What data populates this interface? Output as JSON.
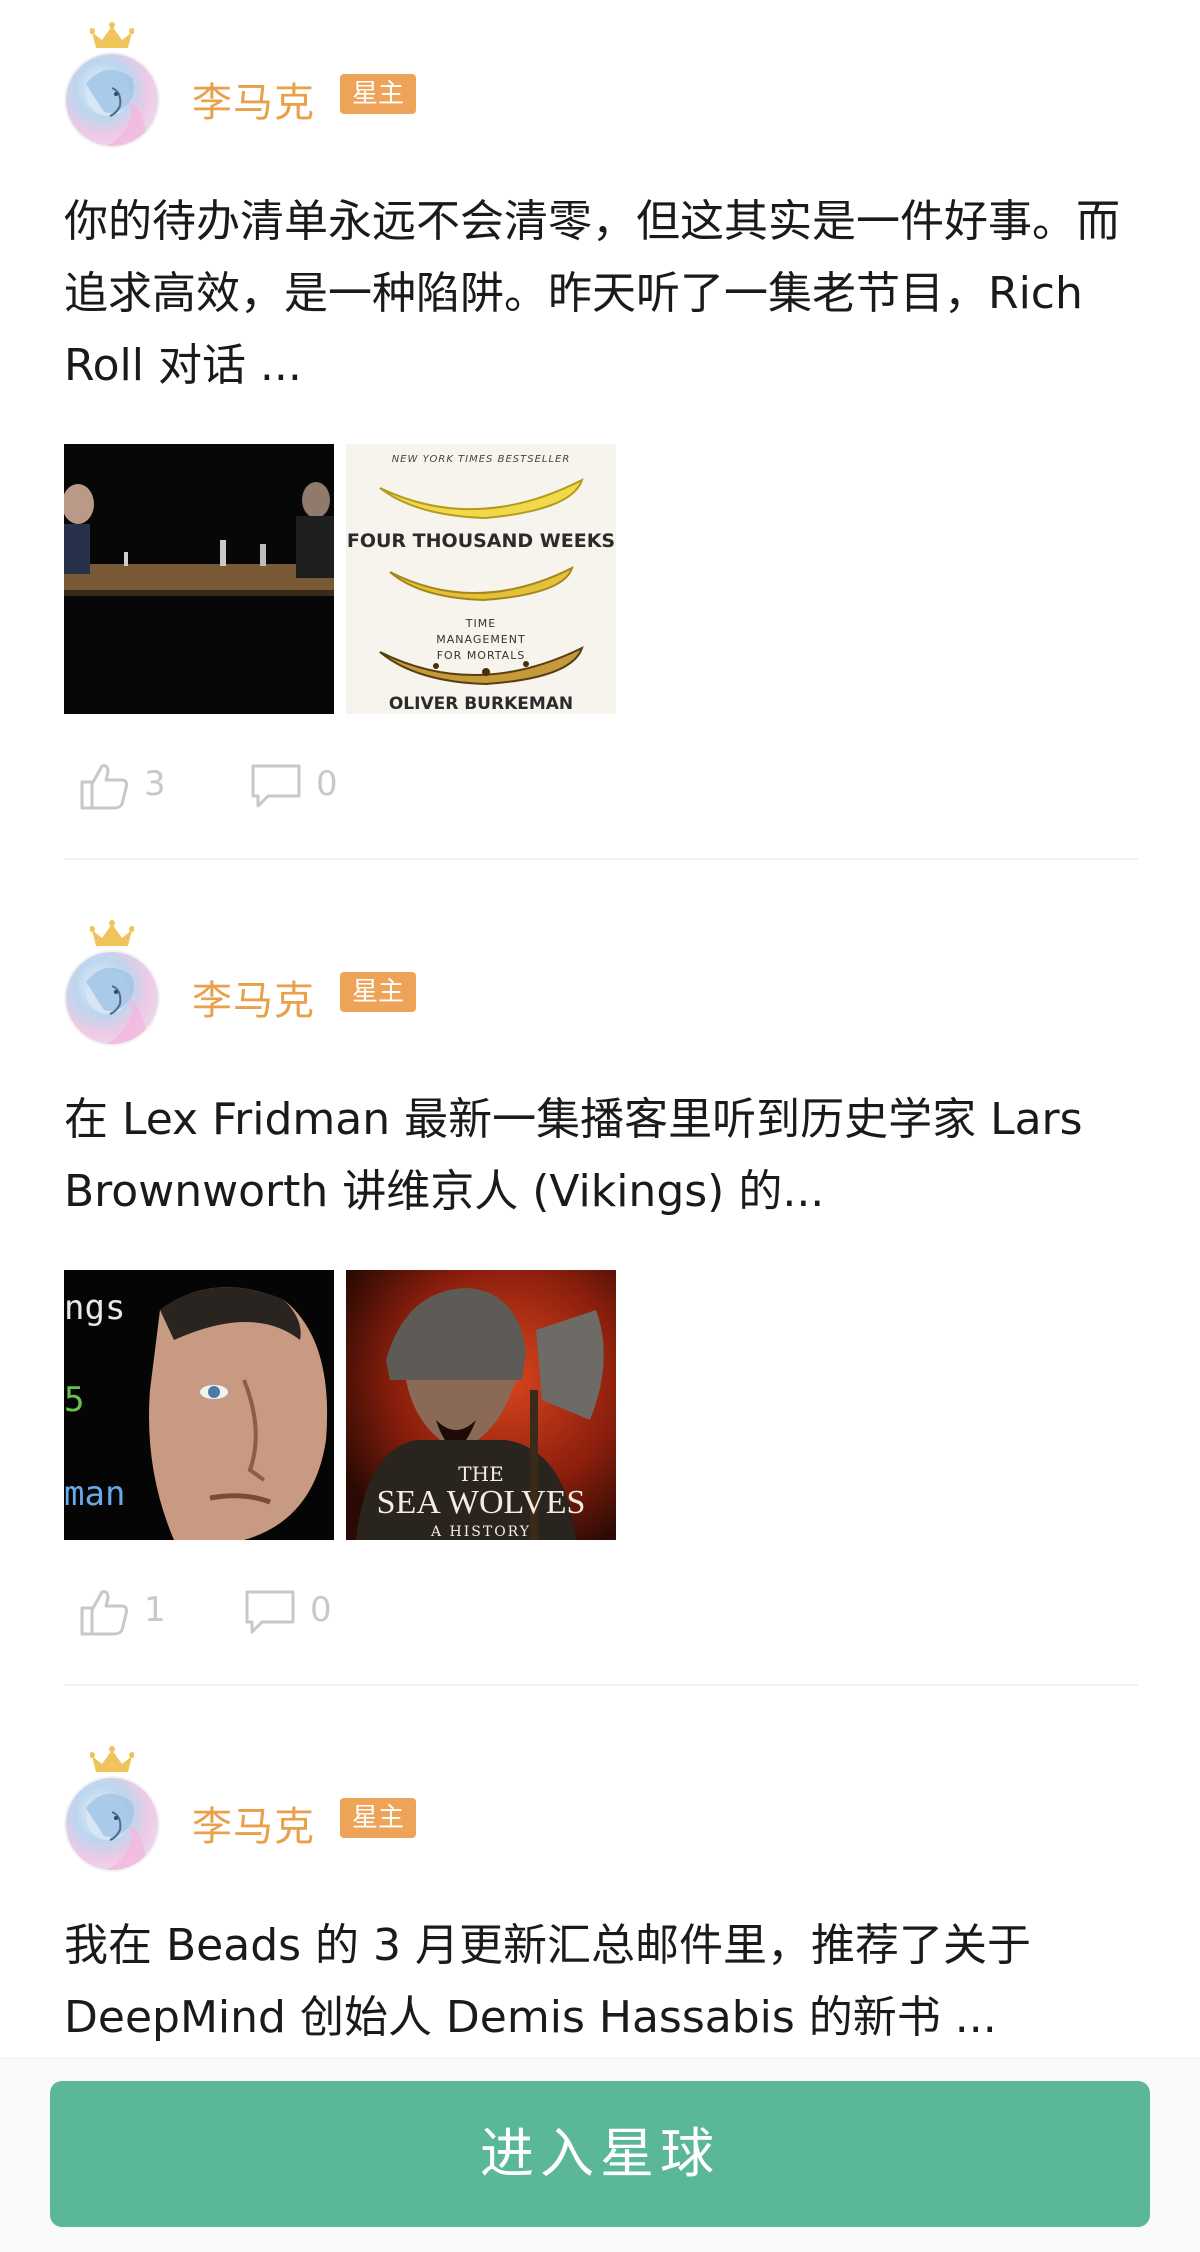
{
  "posts": [
    {
      "author": "李马克",
      "badge": "星主",
      "text": "你的待办清单永远不会清零，但这其实是一件好事。而追求高效，是一种陷阱。昨天听了一集老节目，Rich Roll 对话 ...",
      "images": [
        {
          "icon": "video-still-image"
        },
        {
          "icon": "book-cover-image",
          "top_label": "NEW YORK TIMES BESTSELLER",
          "title": "FOUR THOUSAND WEEKS",
          "subtitle": "TIME MANAGEMENT FOR MORTALS",
          "author": "OLIVER BURKEMAN"
        }
      ],
      "likes": "3",
      "comments": "0"
    },
    {
      "author": "李马克",
      "badge": "星主",
      "text": "在 Lex Fridman 最新一集播客里听到历史学家 Lars Brownworth 讲维京人 (Vikings) 的...",
      "images": [
        {
          "icon": "portrait-image",
          "overlay_top": "ngs",
          "overlay_mid": "5",
          "overlay_bottom": "man"
        },
        {
          "icon": "book-cover-image",
          "title_small": "THE",
          "title": "SEA WOLVES",
          "subtitle": "A HISTORY"
        }
      ],
      "likes": "1",
      "comments": "0"
    },
    {
      "author": "李马克",
      "badge": "星主",
      "text": "我在 Beads 的 3 月更新汇总邮件里，推荐了关于 DeepMind 创始人 Demis Hassabis 的新书 ..."
    }
  ],
  "bottom": {
    "join_label": "进入星球"
  },
  "colors": {
    "author": "#e8a04a",
    "badge": "#eda358",
    "button": "#5ab899",
    "icon_gray": "#c8c8c8"
  }
}
